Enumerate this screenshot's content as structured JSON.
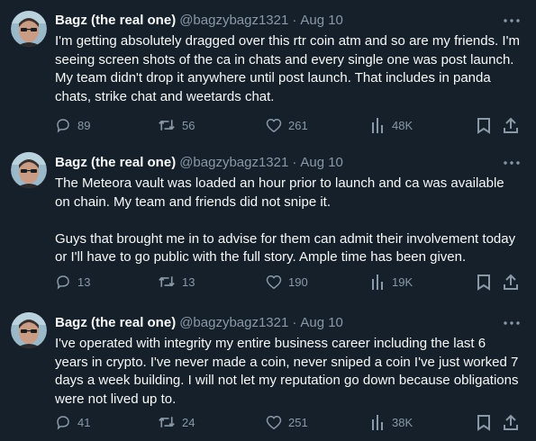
{
  "colors": {
    "background": "#15202b",
    "text": "#f7f9f9",
    "secondary": "#8b98a5"
  },
  "tweets": [
    {
      "display_name": "Bagz (the real one)",
      "handle": "@bagzybagz1321",
      "separator": "·",
      "date": "Aug 10",
      "text": "I'm getting absolutely dragged over this rtr coin atm and so are my friends. I'm seeing screen shots of the ca in chats and every single one was post launch. My team didn't drop it anywhere until post launch. That includes in panda chats, strike chat and weetards chat.",
      "replies": "89",
      "retweets": "56",
      "likes": "261",
      "views": "48K"
    },
    {
      "display_name": "Bagz (the real one)",
      "handle": "@bagzybagz1321",
      "separator": "·",
      "date": "Aug 10",
      "text": "The Meteora vault was loaded an hour prior to launch and ca was available on chain. My team and friends did not snipe it.\n\nGuys that brought me in to advise for them can admit their involvement today or I'll have to go public with the full story. Ample time has been given.",
      "replies": "13",
      "retweets": "13",
      "likes": "190",
      "views": "19K"
    },
    {
      "display_name": "Bagz (the real one)",
      "handle": "@bagzybagz1321",
      "separator": "·",
      "date": "Aug 10",
      "text": "I've operated with integrity my entire business career including the last 6 years in crypto. I've never made a coin, never sniped a coin I've just worked 7 days a week building. I will not let my reputation go down because obligations were not lived up to.",
      "replies": "41",
      "retweets": "24",
      "likes": "251",
      "views": "38K"
    }
  ],
  "icons": {
    "more": "more-horizontal-icon",
    "reply": "reply-icon",
    "retweet": "retweet-icon",
    "like": "heart-icon",
    "views": "views-chart-icon",
    "bookmark": "bookmark-icon",
    "share": "share-icon"
  }
}
